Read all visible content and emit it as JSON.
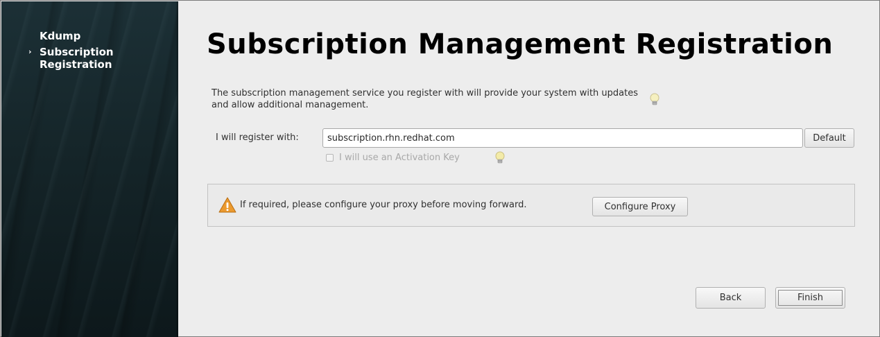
{
  "sidebar": {
    "items": [
      {
        "label": "Kdump",
        "active": false
      },
      {
        "label": "Subscription Registration",
        "active": true,
        "marker": "›"
      }
    ]
  },
  "page": {
    "title": "Subscription Management Registration",
    "description": "The subscription management service you register with will provide your system with updates and allow additional management."
  },
  "register": {
    "label": "I will register with:",
    "server_value": "subscription.rhn.redhat.com",
    "default_button": "Default",
    "activation_key_label": "I will use an Activation Key",
    "activation_key_checked": false
  },
  "proxy": {
    "message": "If required, please configure your proxy before moving forward.",
    "button": "Configure Proxy"
  },
  "footer": {
    "back_button": "Back",
    "finish_button": "Finish"
  },
  "icons": {
    "info": "lightbulb-icon",
    "warning": "warning-triangle-icon"
  },
  "colors": {
    "sidebar_bg": "#152529",
    "warning": "#e8a23a",
    "bulb": "#f2e8a8"
  }
}
